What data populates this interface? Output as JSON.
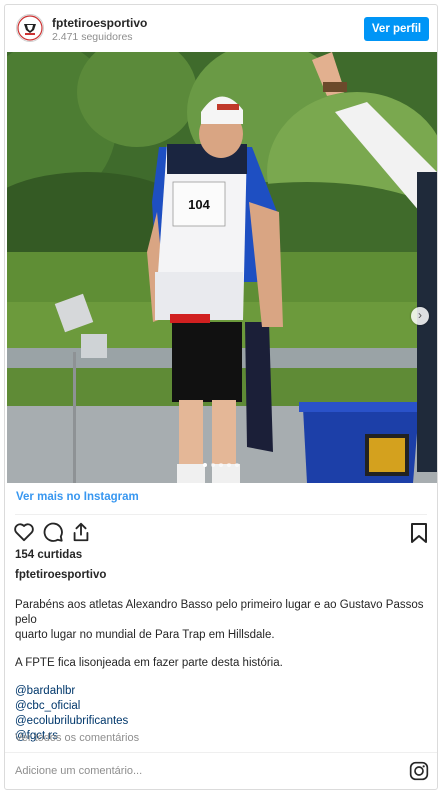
{
  "header": {
    "username": "fptetiroesportivo",
    "followers": "2.471 seguidores",
    "profile_button": "Ver perfil"
  },
  "media": {
    "bib_number": "104",
    "slide_count": 5,
    "active_slide": 1,
    "next_icon": "chevron-right-icon"
  },
  "links": {
    "view_more": "Ver mais no Instagram"
  },
  "actions": {
    "icons": [
      "heart-icon",
      "comment-icon",
      "share-icon",
      "bookmark-icon"
    ]
  },
  "post": {
    "likes": "154 curtidas",
    "username": "fptetiroesportivo",
    "caption_line1": "Parabéns aos atletas Alexandro Basso pelo primeiro lugar e ao Gustavo Passos pelo",
    "caption_line2": "quarto lugar no mundial de Para Trap em Hillsdale.",
    "caption_line3": "A FPTE fica lisonjeada em fazer parte desta história.",
    "mentions": [
      "@bardahlbr",
      "@cbc_oficial",
      "@ecolubrilubrificantes",
      "@fgct.rs"
    ],
    "view_all_comments": "Ver todos os comentários"
  },
  "comment": {
    "placeholder": "Adicione um comentário..."
  },
  "colors": {
    "accent": "#0095f6",
    "link": "#3897f0",
    "muted": "#8e8e8e"
  }
}
